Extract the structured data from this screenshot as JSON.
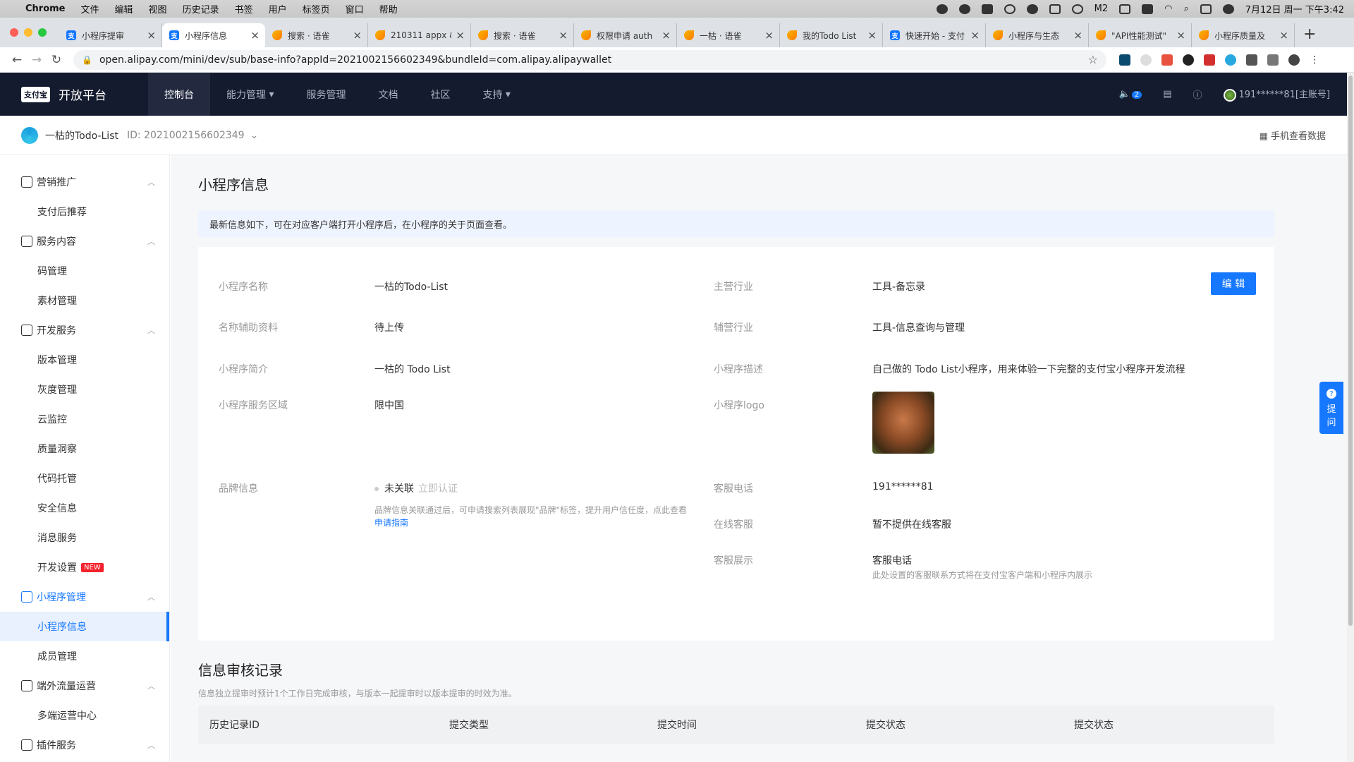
{
  "menubar": {
    "app": "Chrome",
    "items": [
      "文件",
      "编辑",
      "视图",
      "历史记录",
      "书签",
      "用户",
      "标签页",
      "窗口",
      "帮助"
    ],
    "clock": "7月12日 周一 下午3:42",
    "m_badge": "2"
  },
  "tabs": [
    {
      "title": "小程序提审",
      "fav": "alipay"
    },
    {
      "title": "小程序信息",
      "fav": "alipay"
    },
    {
      "title": "搜索 · 语雀",
      "fav": "yuque"
    },
    {
      "title": "210311 appx &",
      "fav": "yuque"
    },
    {
      "title": "搜索 · 语雀",
      "fav": "yuque"
    },
    {
      "title": "权限申请 auth",
      "fav": "yuque"
    },
    {
      "title": "一枯 · 语雀",
      "fav": "yuque"
    },
    {
      "title": "我的Todo List",
      "fav": "yuque"
    },
    {
      "title": "快速开始 - 支付",
      "fav": "alipay"
    },
    {
      "title": "小程序与生态",
      "fav": "yuque"
    },
    {
      "title": "\"API性能测试\"",
      "fav": "yuque"
    },
    {
      "title": "小程序质量及",
      "fav": "yuque"
    }
  ],
  "address": {
    "url": "open.alipay.com/mini/dev/sub/base-info?appId=2021002156602349&bundleId=com.alipay.alipaywallet"
  },
  "header": {
    "logo": "支付宝",
    "platform": "开放平台",
    "nav": [
      "控制台",
      "能力管理",
      "服务管理",
      "文档",
      "社区",
      "支持"
    ],
    "notify_count": "2",
    "account": "191******81[主账号]"
  },
  "sub": {
    "app_name": "一枯的Todo-List",
    "app_id": "ID: 2021002156602349",
    "mobile_data": "手机查看数据"
  },
  "sidebar": {
    "groups": [
      {
        "label": "营销推广",
        "items": [
          "支付后推荐"
        ]
      },
      {
        "label": "服务内容",
        "items": [
          "码管理",
          "素材管理"
        ]
      },
      {
        "label": "开发服务",
        "items": [
          "版本管理",
          "灰度管理",
          "云监控",
          "质量洞察",
          "代码托管",
          "安全信息",
          "消息服务",
          "开发设置"
        ]
      },
      {
        "label": "小程序管理",
        "items": [
          "小程序信息",
          "成员管理"
        ]
      },
      {
        "label": "端外流量运营",
        "items": [
          "多端运营中心"
        ]
      },
      {
        "label": "插件服务",
        "items": []
      }
    ],
    "new_tag": "NEW"
  },
  "main": {
    "title": "小程序信息",
    "notice": "最新信息如下，可在对应客户端打开小程序后，在小程序的关于页面查看。",
    "edit_label": "编 辑",
    "fields": {
      "name_label": "小程序名称",
      "name_value": "一枯的Todo-List",
      "aux_label": "名称辅助资料",
      "aux_value": "待上传",
      "intro_label": "小程序简介",
      "intro_value": "一枯的 Todo List",
      "region_label": "小程序服务区域",
      "region_value": "限中国",
      "brand_label": "品牌信息",
      "brand_value": "未关联",
      "brand_action": "立即认证",
      "brand_desc": "品牌信息关联通过后，可申请搜索列表展现\"品牌\"标签，提升用户信任度，点此查看",
      "brand_link": "申请指南",
      "industry_label": "主营行业",
      "industry_value": "工具-备忘录",
      "sub_industry_label": "辅营行业",
      "sub_industry_value": "工具-信息查询与管理",
      "desc_label": "小程序描述",
      "desc_value": "自己做的 Todo List小程序，用来体验一下完整的支付宝小程序开发流程",
      "logo_label": "小程序logo",
      "phone_label": "客服电话",
      "phone_value": "191******81",
      "online_label": "在线客服",
      "online_value": "暂不提供在线客服",
      "display_label": "客服展示",
      "display_value": "客服电话",
      "display_desc": "此处设置的客服联系方式将在支付宝客户端和小程序内展示"
    },
    "audit": {
      "title": "信息审核记录",
      "subtitle": "信息独立提审时预计1个工作日完成审核，与版本一起提审时以版本提审的时效为准。",
      "columns": [
        "历史记录ID",
        "提交类型",
        "提交时间",
        "提交状态",
        "提交状态"
      ]
    }
  },
  "help_float": {
    "label_1": "提",
    "label_2": "问"
  }
}
